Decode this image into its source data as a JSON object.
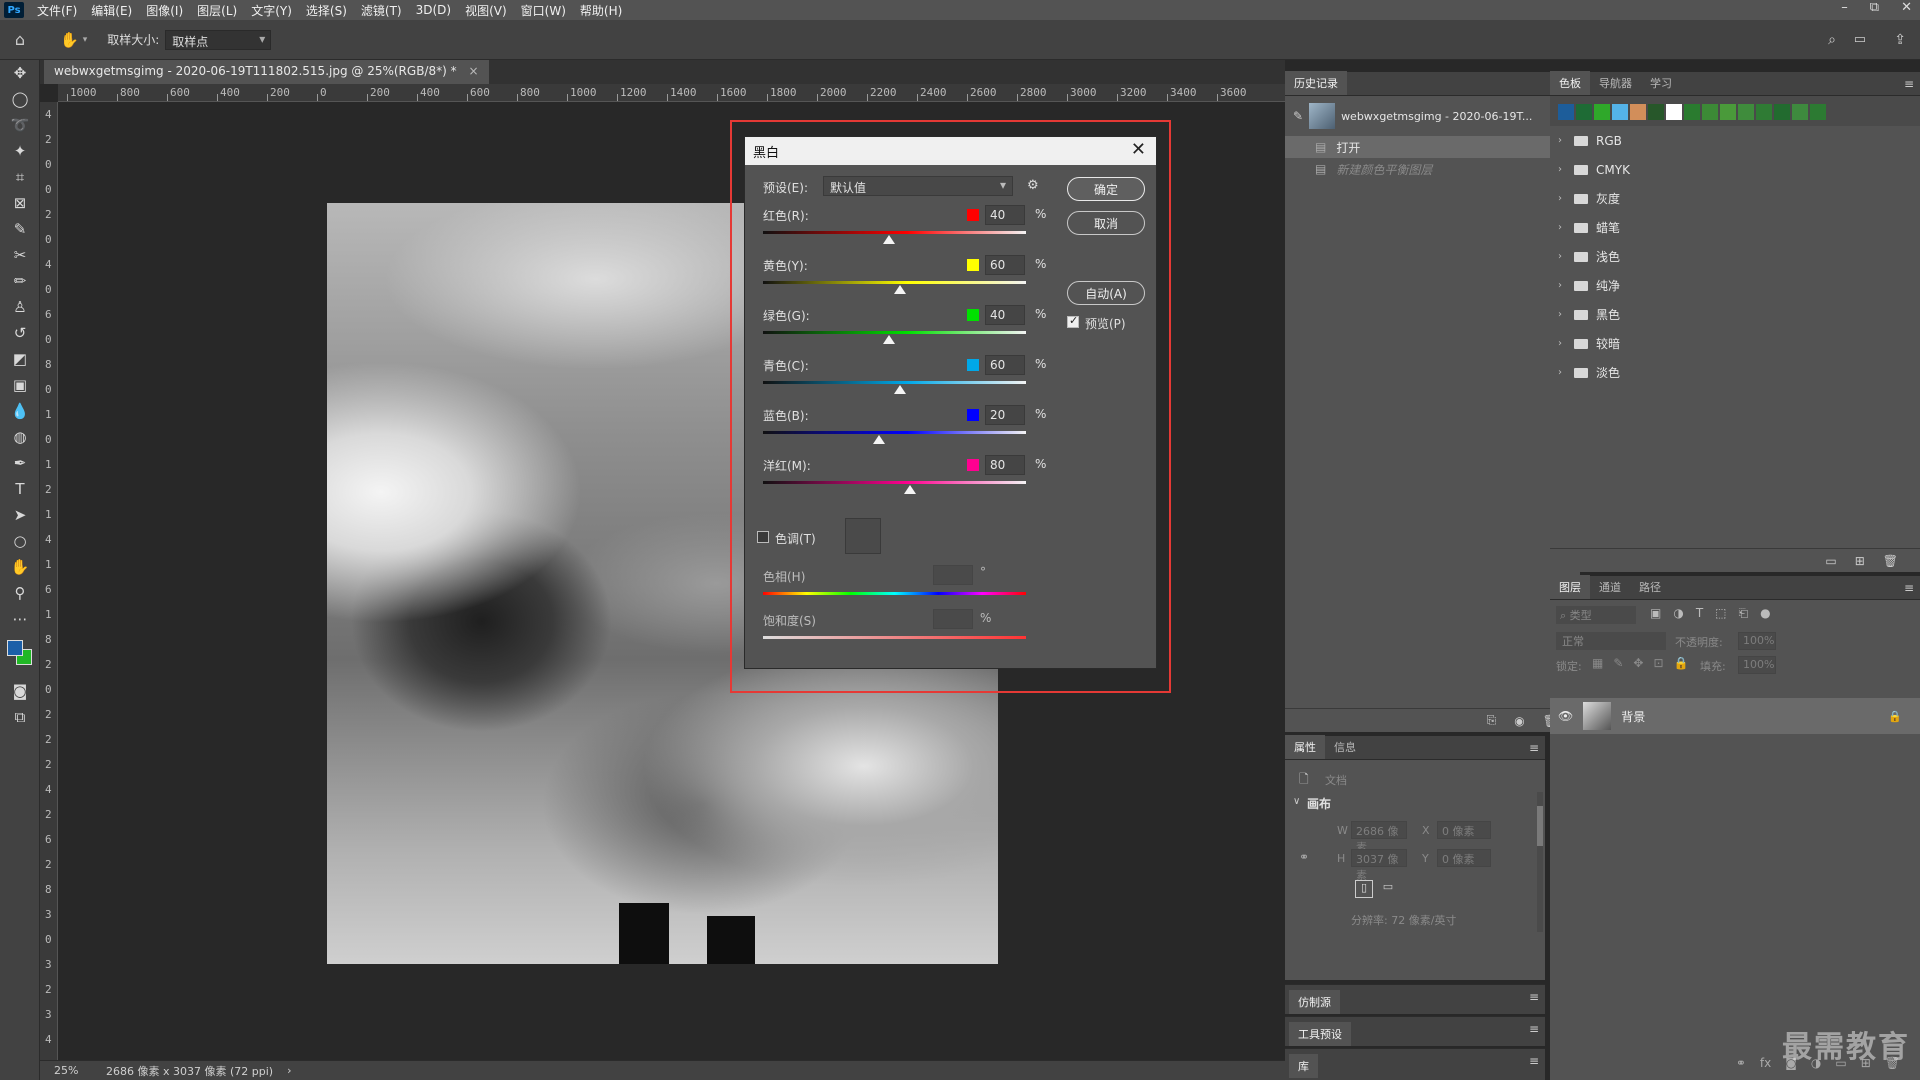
{
  "app": {
    "logo": "Ps",
    "menu": [
      "文件(F)",
      "编辑(E)",
      "图像(I)",
      "图层(L)",
      "文字(Y)",
      "选择(S)",
      "滤镜(T)",
      "3D(D)",
      "视图(V)",
      "窗口(W)",
      "帮助(H)"
    ],
    "window_controls": [
      "–",
      "⧉",
      "✕"
    ]
  },
  "options_bar": {
    "sample_size_label": "取样大小:",
    "sample_size_value": "取样点"
  },
  "document": {
    "tab_title": "webwxgetmsgimg - 2020-06-19T111802.515.jpg @ 25%(RGB/8*) *",
    "tab_close": "×",
    "ruler_h": [
      "1000",
      "800",
      "600",
      "400",
      "200",
      "0",
      "200",
      "400",
      "600",
      "800",
      "1000",
      "1200",
      "1400",
      "1600",
      "1800",
      "2000",
      "2200",
      "2400",
      "2600",
      "2800",
      "3000",
      "3200",
      "3400",
      "3600"
    ],
    "ruler_v": [
      "4",
      "2",
      "0",
      "0",
      "2",
      "0",
      "4",
      "0",
      "6",
      "0",
      "8",
      "0",
      "1",
      "0",
      "1",
      "2",
      "1",
      "4",
      "1",
      "6",
      "1",
      "8",
      "2",
      "0",
      "2",
      "2",
      "2",
      "4",
      "2",
      "6",
      "2",
      "8",
      "3",
      "0",
      "3",
      "2",
      "3",
      "4"
    ]
  },
  "status_bar": {
    "zoom": "25%",
    "doc_info": "2686 像素 x 3037 像素 (72 ppi)",
    "arrow": "›"
  },
  "dialog": {
    "title": "黑白",
    "close": "✕",
    "preset_label": "预设(E):",
    "preset_value": "默认值",
    "ok": "确定",
    "cancel": "取消",
    "auto": "自动(A)",
    "preview_label": "预览(P)",
    "preview_checked": true,
    "percent": "%",
    "sliders": [
      {
        "label": "红色(R):",
        "value": "40",
        "color": "#ff0000",
        "pos": 0.48
      },
      {
        "label": "黄色(Y):",
        "value": "60",
        "color": "#ffff00",
        "pos": 0.52
      },
      {
        "label": "绿色(G):",
        "value": "40",
        "color": "#00e000",
        "pos": 0.48
      },
      {
        "label": "青色(C):",
        "value": "60",
        "color": "#00a8e8",
        "pos": 0.52
      },
      {
        "label": "蓝色(B):",
        "value": "20",
        "color": "#0000ff",
        "pos": 0.44
      },
      {
        "label": "洋红(M):",
        "value": "80",
        "color": "#ff0090",
        "pos": 0.56
      }
    ],
    "tint_label": "色调(T)",
    "tint_checked": false,
    "hue_label": "色相(H)",
    "hue_unit": "°",
    "saturation_label": "饱和度(S)",
    "saturation_unit": "%"
  },
  "history_panel": {
    "tab": "历史记录",
    "snapshot_name": "webwxgetmsgimg - 2020-06-19T...",
    "items": [
      {
        "label": "打开",
        "active": true
      },
      {
        "label": "新建颜色平衡图层",
        "active": false
      }
    ]
  },
  "swatches_panel": {
    "tabs": [
      "色板",
      "导航器",
      "学习"
    ],
    "colors": [
      "#1d5d9a",
      "#1e6b35",
      "#2fa82a",
      "#54b3e8",
      "#d28e5a",
      "#27572a",
      "#ffffff",
      "#2a7b2f",
      "#3c8a36",
      "#4a9a3a",
      "#3f8c3c",
      "#2f7b34",
      "#226b2f",
      "#3e8a3e",
      "#2c7a32"
    ],
    "folders": [
      "RGB",
      "CMYK",
      "灰度",
      "蜡笔",
      "浅色",
      "纯净",
      "黑色",
      "较暗",
      "淡色"
    ]
  },
  "layers_panel": {
    "tabs": [
      "图层",
      "通道",
      "路径"
    ],
    "filter_placeholder": "类型",
    "blend_mode": "正常",
    "opacity_label": "不透明度:",
    "opacity_value": "100%",
    "lock_label": "锁定:",
    "fill_label": "填充:",
    "fill_value": "100%",
    "layer_name": "背景"
  },
  "properties_panel": {
    "tabs": [
      "属性",
      "信息"
    ],
    "doc_label": "文档",
    "canvas_label": "画布",
    "w_label": "W",
    "w_value": "2686 像素",
    "h_label": "H",
    "h_value": "3037 像素",
    "x_label": "X",
    "x_value": "0 像素",
    "y_label": "Y",
    "y_value": "0 像素",
    "resolution": "分辨率: 72 像素/英寸"
  },
  "collapsed_panels": [
    "仿制源",
    "工具预设",
    "库"
  ],
  "watermark": "最需教育"
}
